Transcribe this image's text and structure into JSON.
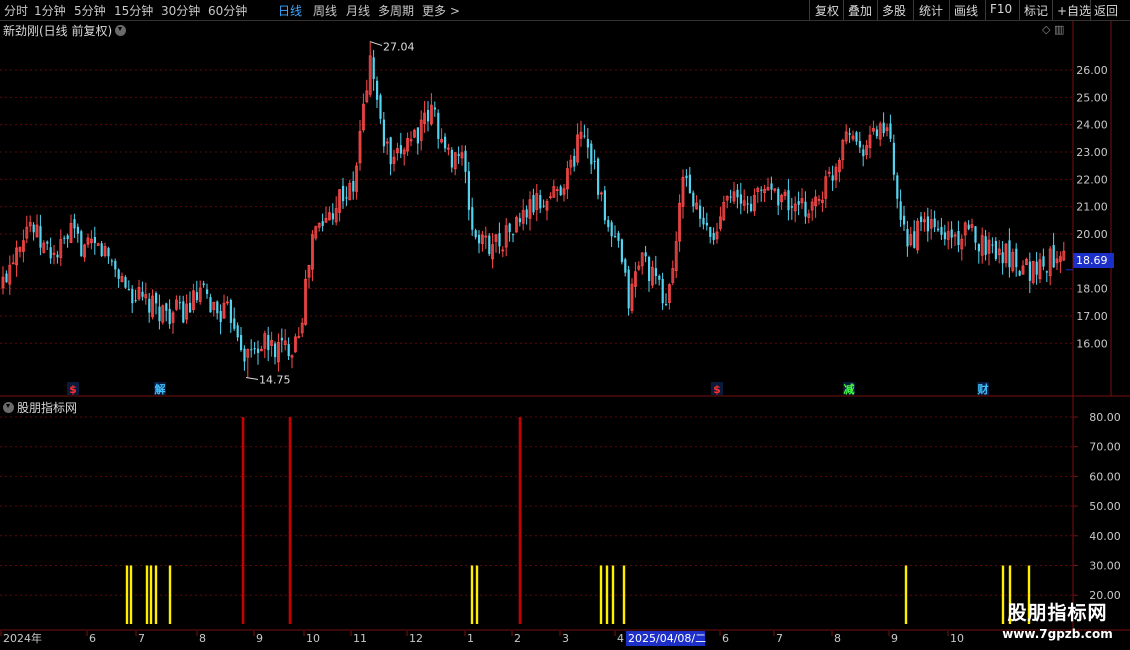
{
  "toolbar": {
    "periods": [
      {
        "label": "分时",
        "active": false
      },
      {
        "label": "1分钟",
        "active": false
      },
      {
        "label": "5分钟",
        "active": false
      },
      {
        "label": "15分钟",
        "active": false
      },
      {
        "label": "30分钟",
        "active": false
      },
      {
        "label": "60分钟",
        "active": false
      },
      {
        "label": "日线",
        "active": true
      },
      {
        "label": "周线",
        "active": false
      },
      {
        "label": "月线",
        "active": false
      },
      {
        "label": "多周期",
        "active": false
      }
    ],
    "more_label": "更多 >",
    "tools": [
      "复权",
      "叠加",
      "多股",
      "统计",
      "画线",
      "F10",
      "标记",
      "+自选",
      "返回"
    ]
  },
  "main_chart": {
    "title": "新劲刚(日线 前复权)",
    "price_axis": [
      "26.00",
      "25.00",
      "24.00",
      "23.00",
      "22.00",
      "21.00",
      "20.00",
      "18.00",
      "17.00",
      "16.00"
    ],
    "current_price": "18.69",
    "high_label": "27.04",
    "low_label": "14.75",
    "event_markers": [
      {
        "label": "$",
        "color": "#ff3030"
      },
      {
        "label": "解",
        "color": "#40c0ff"
      },
      {
        "label": "$",
        "color": "#ff3030"
      },
      {
        "label": "减",
        "color": "#40ff40"
      },
      {
        "label": "财",
        "color": "#40c0ff"
      }
    ]
  },
  "indicator": {
    "title": "股朋指标网",
    "axis": [
      "80.00",
      "70.00",
      "60.00",
      "50.00",
      "40.00",
      "30.00",
      "20.00"
    ]
  },
  "time_axis": [
    "2024年",
    "6",
    "7",
    "8",
    "9",
    "10",
    "11",
    "12",
    "1",
    "2",
    "3",
    "4",
    "2025/04/08/二",
    "6",
    "7",
    "8",
    "9",
    "10"
  ],
  "watermark": {
    "title": "股朋指标网",
    "url": "www.7gpzb.com"
  },
  "colors": {
    "up": "#ff4a4a",
    "down": "#54d4f0",
    "signal_red": "#c80000",
    "signal_yellow": "#ffee00",
    "active_period": "#3fa7ff",
    "grid": "#5a0a0a"
  },
  "chart_data": {
    "type": "candlestick",
    "title": "新劲刚(日线 前复权)",
    "price_range": [
      15.0,
      27.04
    ],
    "high": 27.04,
    "low": 14.75,
    "last": 18.69,
    "close_path": [
      [
        0,
        18.0
      ],
      [
        15,
        19.6
      ],
      [
        28,
        20.5
      ],
      [
        40,
        19.6
      ],
      [
        55,
        19.2
      ],
      [
        70,
        20.0
      ],
      [
        85,
        19.4
      ],
      [
        100,
        19.5
      ],
      [
        112,
        18.9
      ],
      [
        128,
        17.9
      ],
      [
        150,
        17.3
      ],
      [
        170,
        17.1
      ],
      [
        185,
        17.2
      ],
      [
        200,
        17.8
      ],
      [
        215,
        17.2
      ],
      [
        232,
        17.0
      ],
      [
        245,
        15.5
      ],
      [
        260,
        16.0
      ],
      [
        275,
        15.8
      ],
      [
        290,
        15.9
      ],
      [
        300,
        16.8
      ],
      [
        312,
        20.0
      ],
      [
        325,
        20.5
      ],
      [
        340,
        21.5
      ],
      [
        352,
        21.5
      ],
      [
        362,
        24.5
      ],
      [
        370,
        26.5
      ],
      [
        380,
        23.8
      ],
      [
        392,
        22.3
      ],
      [
        405,
        23.5
      ],
      [
        420,
        23.8
      ],
      [
        432,
        24.6
      ],
      [
        445,
        22.8
      ],
      [
        460,
        23.0
      ],
      [
        472,
        20.0
      ],
      [
        485,
        19.6
      ],
      [
        500,
        19.8
      ],
      [
        515,
        20.3
      ],
      [
        530,
        21.0
      ],
      [
        545,
        21.2
      ],
      [
        560,
        21.8
      ],
      [
        572,
        22.6
      ],
      [
        580,
        24.0
      ],
      [
        592,
        22.8
      ],
      [
        605,
        20.2
      ],
      [
        618,
        19.4
      ],
      [
        628,
        17.5
      ],
      [
        640,
        19.3
      ],
      [
        652,
        18.4
      ],
      [
        666,
        17.4
      ],
      [
        676,
        20.0
      ],
      [
        684,
        22.4
      ],
      [
        693,
        21.0
      ],
      [
        702,
        20.2
      ],
      [
        715,
        19.8
      ],
      [
        725,
        21.9
      ],
      [
        738,
        21.0
      ],
      [
        752,
        21.2
      ],
      [
        766,
        21.8
      ],
      [
        780,
        21.4
      ],
      [
        795,
        20.8
      ],
      [
        810,
        21.0
      ],
      [
        822,
        21.6
      ],
      [
        835,
        22.5
      ],
      [
        846,
        24.2
      ],
      [
        857,
        23.2
      ],
      [
        868,
        23.4
      ],
      [
        880,
        24.0
      ],
      [
        890,
        23.2
      ],
      [
        898,
        20.2
      ],
      [
        910,
        19.8
      ],
      [
        925,
        20.4
      ],
      [
        940,
        20.0
      ],
      [
        955,
        19.9
      ],
      [
        970,
        20.0
      ],
      [
        985,
        19.6
      ],
      [
        1000,
        19.4
      ],
      [
        1015,
        19.0
      ],
      [
        1030,
        18.7
      ],
      [
        1045,
        18.9
      ],
      [
        1060,
        19.5
      ],
      [
        1066,
        19.7
      ]
    ],
    "indicator": {
      "name": "股朋指标网",
      "ylim": [
        20,
        80
      ],
      "red_signals": {
        "value": 80,
        "x_at": [
          243,
          290,
          520
        ]
      },
      "yellow_signals": {
        "value": 30,
        "x_at": [
          127,
          131,
          147,
          151,
          156,
          170,
          472,
          477,
          601,
          607,
          613,
          624,
          906,
          1003,
          1010,
          1029
        ]
      }
    }
  }
}
